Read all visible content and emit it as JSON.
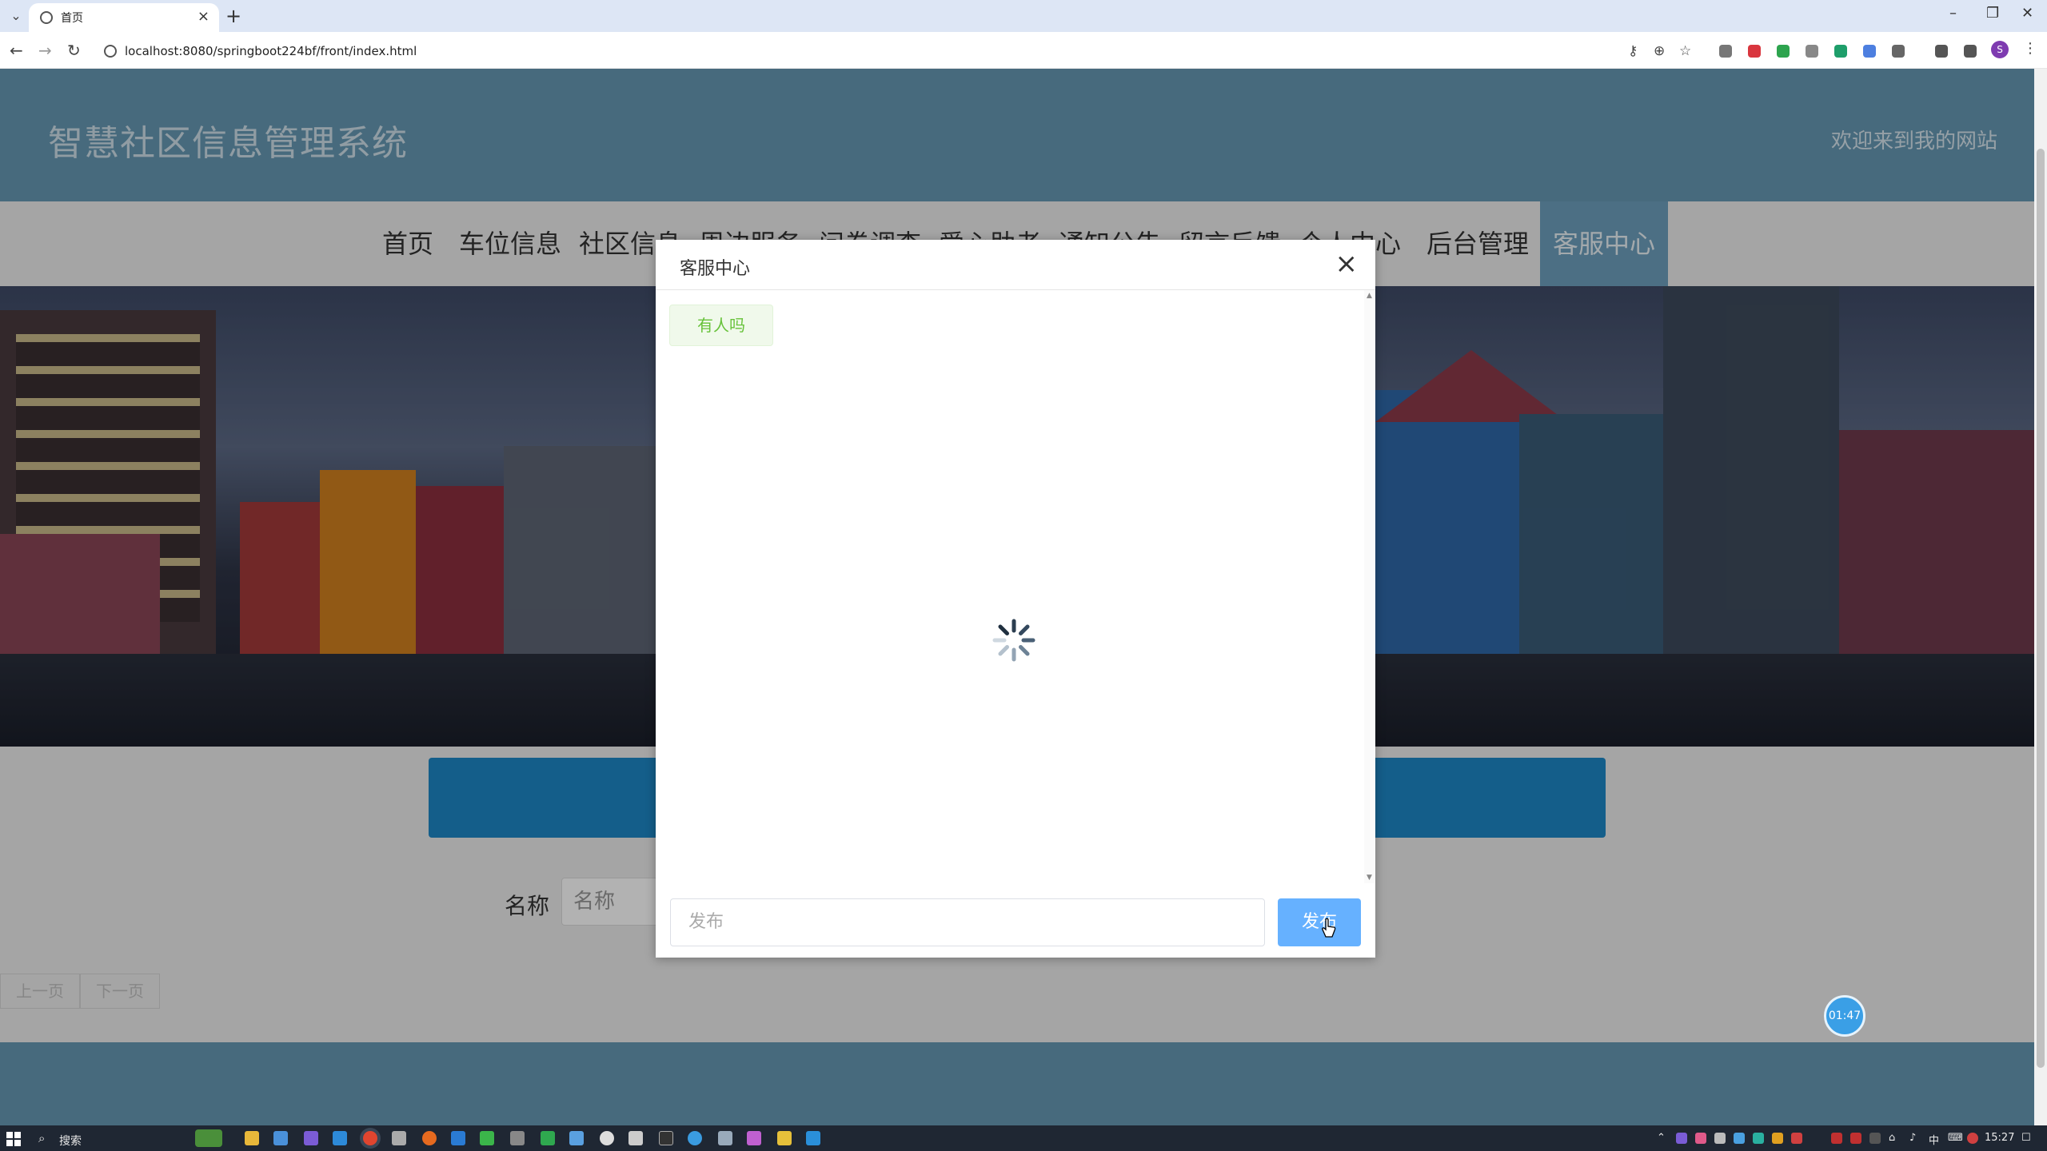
{
  "browser": {
    "tab_title": "首页",
    "url": "localhost:8080/springboot224bf/front/index.html",
    "profile_initial": "S"
  },
  "site": {
    "title": "智慧社区信息管理系统",
    "welcome": "欢迎来到我的网站"
  },
  "nav": {
    "items": [
      "首页",
      "车位信息",
      "社区信息",
      "周边服务",
      "问卷调查",
      "爱心助老",
      "通知公告",
      "留言反馈",
      "个人中心",
      "后台管理",
      "客服中心"
    ],
    "active_index": 10
  },
  "search_form": {
    "label": "名称",
    "placeholder": "名称"
  },
  "pagination": {
    "prev": "上一页",
    "next": "下一页"
  },
  "timer_badge": "01:47",
  "dialog": {
    "title": "客服中心",
    "messages": [
      "有人吗"
    ],
    "input_placeholder": "发布",
    "send_label": "发布"
  },
  "taskbar": {
    "search_label": "搜索",
    "ime": "中",
    "time": "15:27"
  },
  "colors": {
    "header_bg": "#6699b3",
    "nav_active": "#6d9fbd",
    "search_strip": "#1d87c6",
    "send_button": "#66b1ff",
    "bubble_text": "#67c23a"
  },
  "icons": [
    "tab-menu-icon",
    "page-favicon-icon",
    "close-tab-icon",
    "new-tab-icon",
    "back-icon",
    "forward-icon",
    "reload-icon",
    "site-info-icon",
    "password-key-icon",
    "zoom-icon",
    "bookmark-star-icon",
    "close-icon",
    "loading-spinner-icon",
    "windows-start-icon",
    "search-icon"
  ]
}
